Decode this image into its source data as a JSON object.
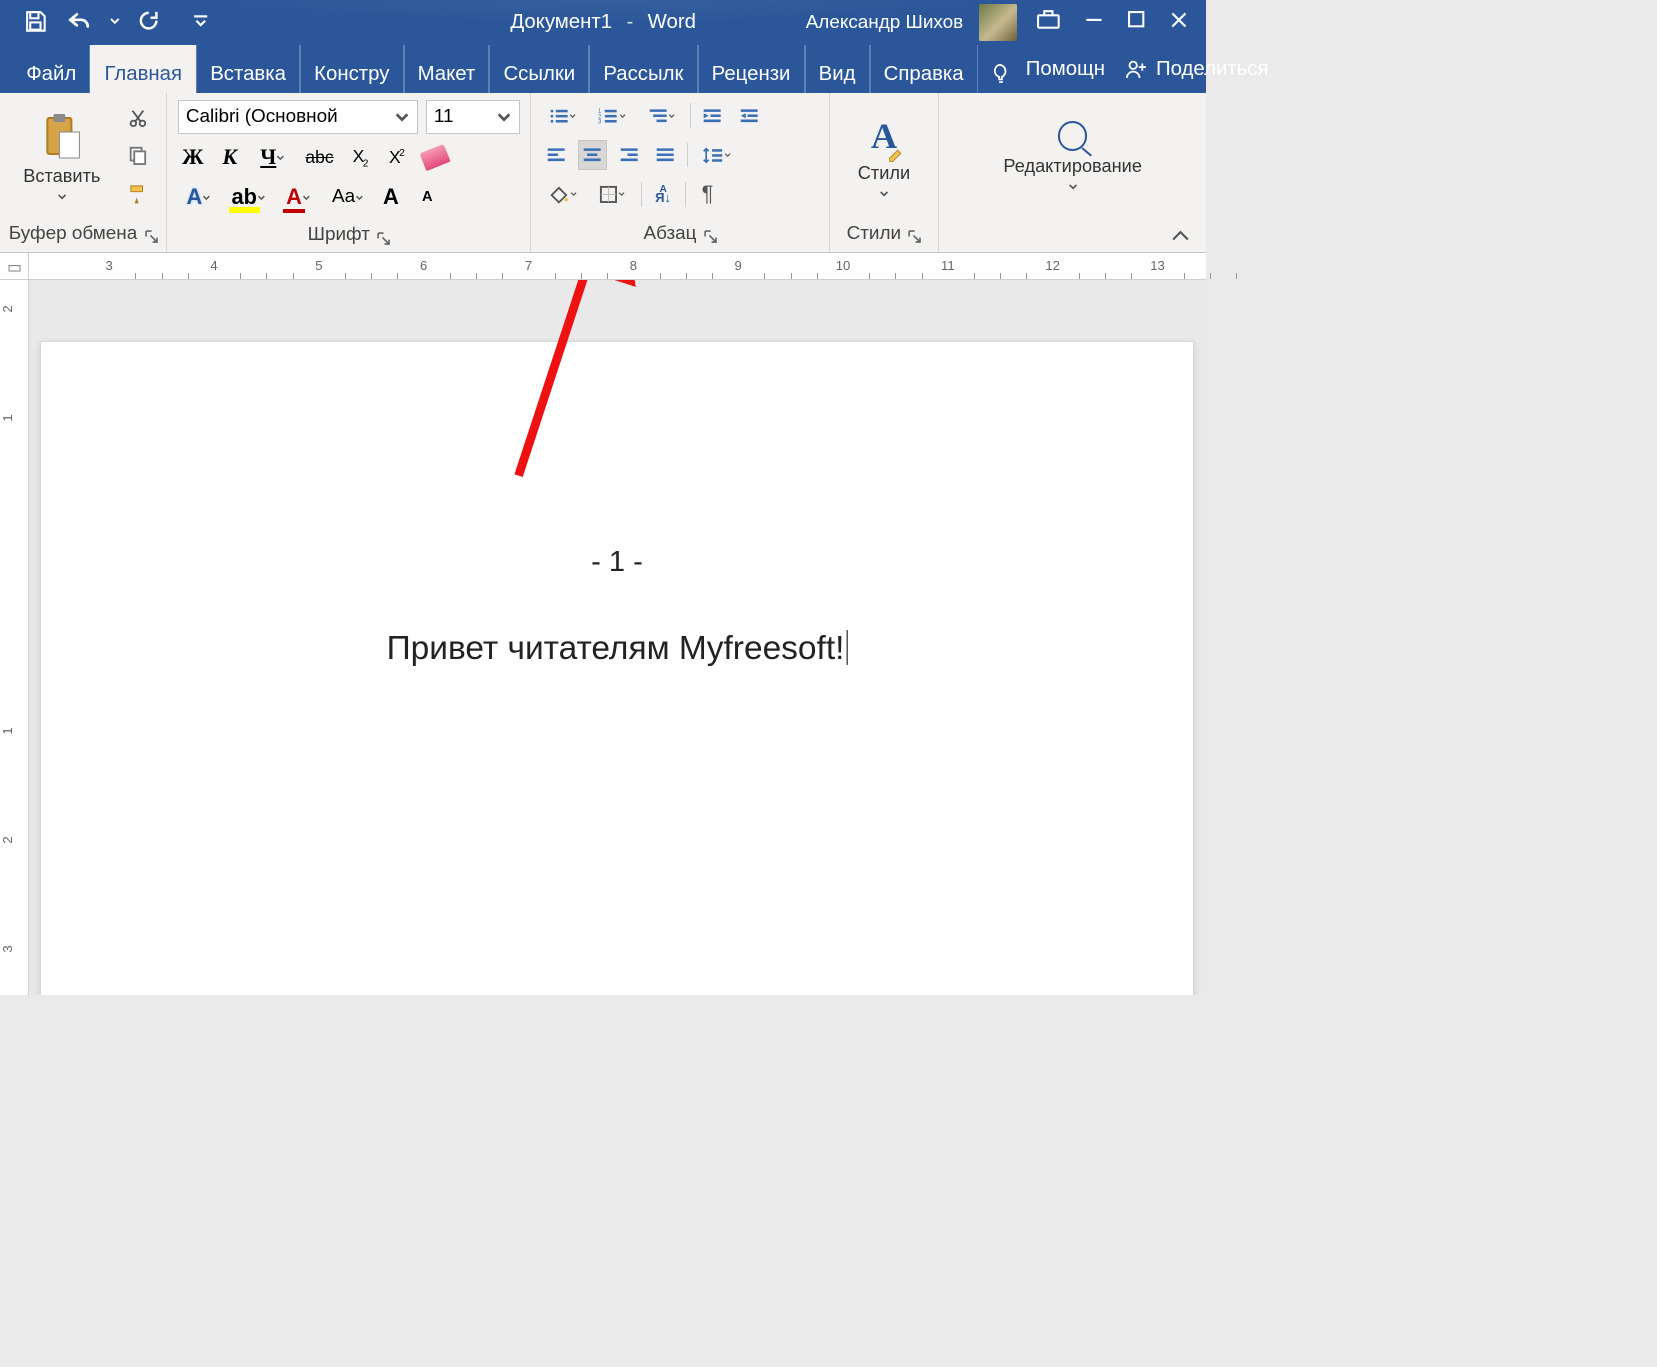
{
  "titlebar": {
    "doc_name": "Документ1",
    "app_name": "Word",
    "user_name": "Александр Шихов"
  },
  "tabs": {
    "file": "Файл",
    "home": "Главная",
    "insert": "Вставка",
    "design": "Констру",
    "layout": "Макет",
    "references": "Ссылки",
    "mailings": "Рассылк",
    "review": "Рецензи",
    "view": "Вид",
    "help": "Справка",
    "tell_me": "Помощн",
    "share": "Поделиться"
  },
  "ribbon": {
    "clipboard": {
      "paste": "Вставить",
      "group_label": "Буфер обмена"
    },
    "font": {
      "font_name": "Calibri (Основной",
      "font_size": "11",
      "bold": "Ж",
      "italic": "К",
      "underline": "Ч",
      "strike": "abc",
      "sub": "X",
      "sub2": "2",
      "sup": "X",
      "sup2": "2",
      "case": "Aa",
      "grow": "A",
      "shrink": "A",
      "group_label": "Шрифт"
    },
    "paragraph": {
      "group_label": "Абзац"
    },
    "styles": {
      "label": "Стили",
      "group_label": "Стили"
    },
    "editing": {
      "label": "Редактирование"
    }
  },
  "ruler": {
    "h": [
      "3",
      "4",
      "5",
      "6",
      "7",
      "8",
      "9",
      "10",
      "11",
      "12",
      "13"
    ],
    "v": [
      "2",
      "1",
      "1",
      "2",
      "3"
    ]
  },
  "document": {
    "page_number": "- 1 -",
    "body": "Привет читателям Myfreesoft!"
  }
}
